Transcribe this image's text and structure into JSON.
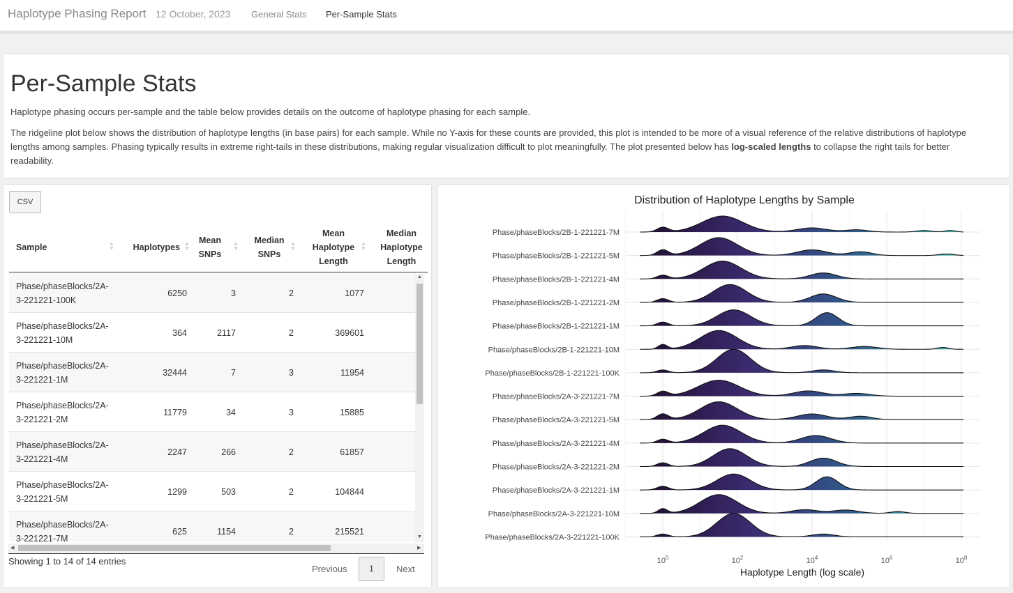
{
  "navbar": {
    "title": "Haplotype Phasing Report",
    "date": "12 October, 2023",
    "tabs": [
      {
        "label": "General Stats",
        "active": false
      },
      {
        "label": "Per-Sample Stats",
        "active": true
      }
    ]
  },
  "intro": {
    "heading": "Per-Sample Stats",
    "para1": "Haplotype phasing occurs per-sample and the table below provides details on the outcome of haplotype phasing for each sample.",
    "para2_before": "The ridgeline plot below shows the distribution of haplotype lengths (in base pairs) for each sample. While no Y-axis for these counts are provided, this plot is intended to be more of a visual reference of the relative distributions of haplotype lengths among samples. Phasing typically results in extreme right-tails in these distributions, making regular visualization difficult to plot meaningfully. The plot presented below has ",
    "para2_bold": "log-scaled lengths",
    "para2_after": " to collapse the right tails for better readability."
  },
  "table": {
    "csv_label": "CSV",
    "columns": [
      "Sample",
      "Haplotypes",
      "Mean\nSNPs",
      "Median\nSNPs",
      "Mean\nHaplotype\nLength",
      "Median\nHaplotype\nLength"
    ],
    "rows": [
      {
        "sample": "Phase/phaseBlocks/2A-\n3-221221-100K",
        "haplotypes": "6250",
        "mean_snps": "3",
        "median_snps": "2",
        "mean_len": "1077"
      },
      {
        "sample": "Phase/phaseBlocks/2A-\n3-221221-10M",
        "haplotypes": "364",
        "mean_snps": "2117",
        "median_snps": "2",
        "mean_len": "369601"
      },
      {
        "sample": "Phase/phaseBlocks/2A-\n3-221221-1M",
        "haplotypes": "32444",
        "mean_snps": "7",
        "median_snps": "3",
        "mean_len": "11954"
      },
      {
        "sample": "Phase/phaseBlocks/2A-\n3-221221-2M",
        "haplotypes": "11779",
        "mean_snps": "34",
        "median_snps": "3",
        "mean_len": "15885"
      },
      {
        "sample": "Phase/phaseBlocks/2A-\n3-221221-4M",
        "haplotypes": "2247",
        "mean_snps": "266",
        "median_snps": "2",
        "mean_len": "61857"
      },
      {
        "sample": "Phase/phaseBlocks/2A-\n3-221221-5M",
        "haplotypes": "1299",
        "mean_snps": "503",
        "median_snps": "2",
        "mean_len": "104844"
      },
      {
        "sample": "Phase/phaseBlocks/2A-\n3-221221-7M",
        "haplotypes": "625",
        "mean_snps": "1154",
        "median_snps": "2",
        "mean_len": "215521"
      }
    ],
    "info": "Showing 1 to 14 of 14 entries",
    "previous": "Previous",
    "page": "1",
    "next": "Next"
  },
  "chart_data": {
    "type": "ridgeline",
    "title": "Distribution of Haplotype Lengths by Sample",
    "xlabel": "Haplotype Length (log scale)",
    "x_scale": "log10",
    "xlim": [
      0.1,
      100000000
    ],
    "x_ticks": [
      {
        "base": "10",
        "exp": "0"
      },
      {
        "base": "10",
        "exp": "2"
      },
      {
        "base": "10",
        "exp": "4"
      },
      {
        "base": "10",
        "exp": "6"
      },
      {
        "base": "10",
        "exp": "8"
      }
    ],
    "fill_gradient": [
      "#1e0f2e",
      "#3b2a6e",
      "#2f5d8c",
      "#3fb8a8"
    ],
    "series": [
      {
        "name": "Phase/phaseBlocks/2B-1-221221-7M",
        "peaks": [
          [
            0.0,
            0.25,
            0.15
          ],
          [
            1.6,
            0.85,
            0.55
          ],
          [
            4.0,
            0.22,
            0.4
          ],
          [
            5.2,
            0.12,
            0.3
          ],
          [
            7.0,
            0.08,
            0.2
          ],
          [
            7.7,
            0.08,
            0.15
          ]
        ]
      },
      {
        "name": "Phase/phaseBlocks/2B-1-221221-5M",
        "peaks": [
          [
            0.0,
            0.3,
            0.15
          ],
          [
            1.5,
            0.95,
            0.5
          ],
          [
            4.0,
            0.3,
            0.4
          ],
          [
            5.3,
            0.2,
            0.3
          ],
          [
            7.6,
            0.08,
            0.2
          ]
        ]
      },
      {
        "name": "Phase/phaseBlocks/2B-1-221221-4M",
        "peaks": [
          [
            0.0,
            0.2,
            0.15
          ],
          [
            1.6,
            0.95,
            0.5
          ],
          [
            4.3,
            0.32,
            0.35
          ]
        ]
      },
      {
        "name": "Phase/phaseBlocks/2B-1-221221-2M",
        "peaks": [
          [
            0.0,
            0.2,
            0.15
          ],
          [
            1.8,
            0.95,
            0.45
          ],
          [
            4.3,
            0.45,
            0.35
          ]
        ]
      },
      {
        "name": "Phase/phaseBlocks/2B-1-221221-1M",
        "peaks": [
          [
            0.0,
            0.2,
            0.15
          ],
          [
            1.9,
            0.85,
            0.45
          ],
          [
            4.4,
            0.7,
            0.3
          ]
        ]
      },
      {
        "name": "Phase/phaseBlocks/2B-1-221221-10M",
        "peaks": [
          [
            0.0,
            0.25,
            0.12
          ],
          [
            1.5,
            1.0,
            0.5
          ],
          [
            3.8,
            0.2,
            0.35
          ],
          [
            5.4,
            0.15,
            0.35
          ],
          [
            7.5,
            0.1,
            0.15
          ]
        ]
      },
      {
        "name": "Phase/phaseBlocks/2B-1-221221-100K",
        "peaks": [
          [
            0.0,
            0.15,
            0.15
          ],
          [
            1.9,
            1.25,
            0.45
          ],
          [
            4.3,
            0.15,
            0.3
          ]
        ]
      },
      {
        "name": "Phase/phaseBlocks/2A-3-221221-7M",
        "peaks": [
          [
            0.0,
            0.25,
            0.15
          ],
          [
            1.5,
            0.85,
            0.55
          ],
          [
            3.9,
            0.28,
            0.4
          ],
          [
            5.2,
            0.15,
            0.35
          ]
        ]
      },
      {
        "name": "Phase/phaseBlocks/2A-3-221221-5M",
        "peaks": [
          [
            0.0,
            0.3,
            0.15
          ],
          [
            1.5,
            0.95,
            0.5
          ],
          [
            4.0,
            0.3,
            0.4
          ],
          [
            5.3,
            0.18,
            0.3
          ]
        ]
      },
      {
        "name": "Phase/phaseBlocks/2A-3-221221-4M",
        "peaks": [
          [
            0.0,
            0.2,
            0.15
          ],
          [
            1.6,
            0.95,
            0.5
          ],
          [
            4.1,
            0.4,
            0.4
          ]
        ]
      },
      {
        "name": "Phase/phaseBlocks/2A-3-221221-2M",
        "peaks": [
          [
            0.0,
            0.2,
            0.15
          ],
          [
            1.8,
            0.95,
            0.45
          ],
          [
            4.3,
            0.45,
            0.35
          ]
        ]
      },
      {
        "name": "Phase/phaseBlocks/2A-3-221221-1M",
        "peaks": [
          [
            0.0,
            0.2,
            0.15
          ],
          [
            1.9,
            0.85,
            0.45
          ],
          [
            4.4,
            0.7,
            0.3
          ]
        ]
      },
      {
        "name": "Phase/phaseBlocks/2A-3-221221-10M",
        "peaks": [
          [
            0.0,
            0.25,
            0.12
          ],
          [
            1.5,
            1.0,
            0.5
          ],
          [
            3.8,
            0.2,
            0.35
          ],
          [
            4.9,
            0.18,
            0.35
          ],
          [
            6.3,
            0.1,
            0.2
          ]
        ]
      },
      {
        "name": "Phase/phaseBlocks/2A-3-221221-100K",
        "peaks": [
          [
            0.0,
            0.15,
            0.15
          ],
          [
            1.9,
            1.25,
            0.45
          ],
          [
            4.3,
            0.15,
            0.3
          ]
        ]
      }
    ]
  }
}
